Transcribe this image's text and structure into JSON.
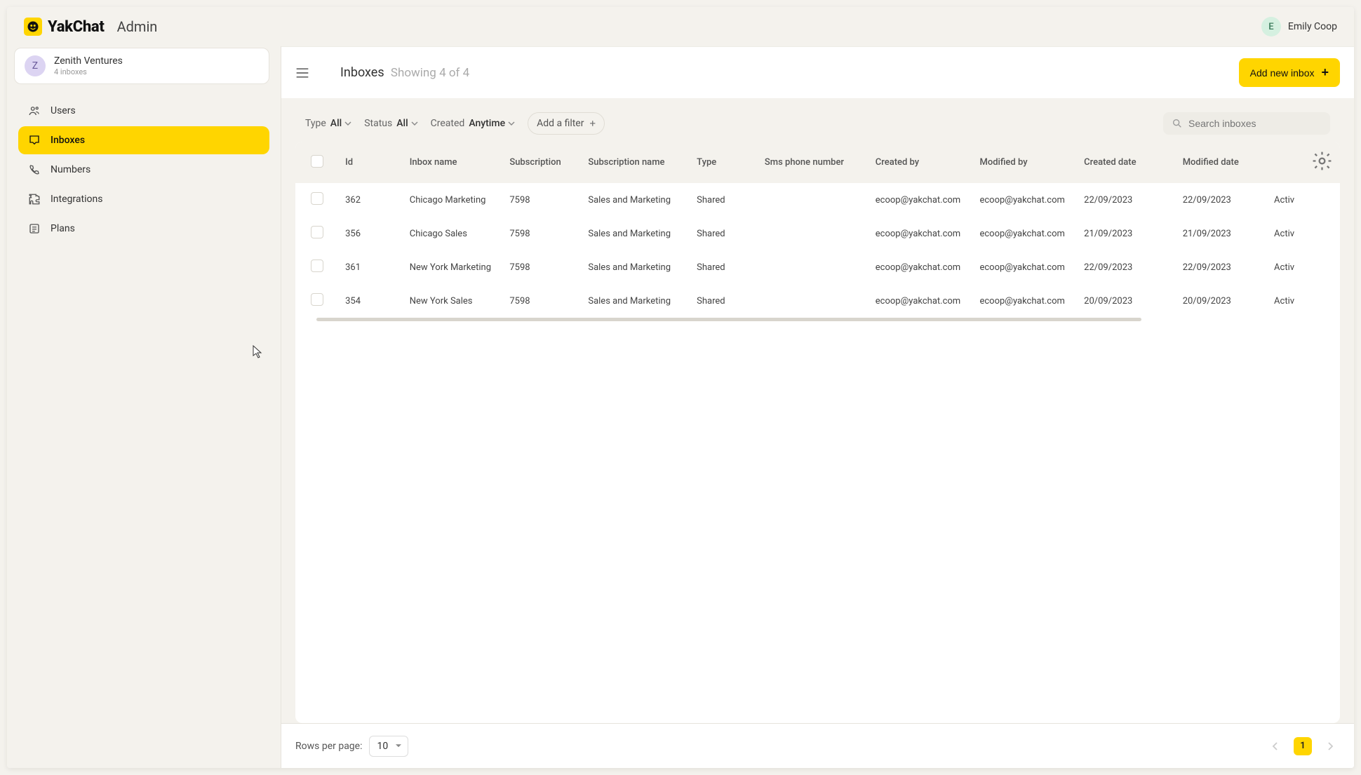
{
  "brand": {
    "name": "YakChat",
    "admin": "Admin"
  },
  "topUser": {
    "initial": "E",
    "name": "Emily Coop"
  },
  "org": {
    "initial": "Z",
    "name": "Zenith Ventures",
    "sub": "4 inboxes"
  },
  "sidebar": {
    "items": [
      {
        "label": "Users"
      },
      {
        "label": "Inboxes"
      },
      {
        "label": "Numbers"
      },
      {
        "label": "Integrations"
      },
      {
        "label": "Plans"
      }
    ],
    "activeIndex": 1
  },
  "page": {
    "title": "Inboxes",
    "subtitle": "Showing 4 of 4",
    "addButton": "Add new inbox"
  },
  "filters": {
    "type": {
      "label": "Type",
      "value": "All"
    },
    "status": {
      "label": "Status",
      "value": "All"
    },
    "created": {
      "label": "Created",
      "value": "Anytime"
    },
    "addFilter": "Add a filter"
  },
  "search": {
    "placeholder": "Search inboxes"
  },
  "table": {
    "headers": [
      "Id",
      "Inbox name",
      "Subscription",
      "Subscription name",
      "Type",
      "Sms phone number",
      "Created by",
      "Modified by",
      "Created date",
      "Modified date",
      ""
    ],
    "rows": [
      {
        "id": "362",
        "inbox": "Chicago Marketing",
        "sub": "7598",
        "subname": "Sales and Marketing",
        "type": "Shared",
        "sms": "",
        "createdBy": "ecoop@yakchat.com",
        "modifiedBy": "ecoop@yakchat.com",
        "createdDate": "22/09/2023",
        "modifiedDate": "22/09/2023",
        "status": "Activ"
      },
      {
        "id": "356",
        "inbox": "Chicago Sales",
        "sub": "7598",
        "subname": "Sales and Marketing",
        "type": "Shared",
        "sms": "",
        "createdBy": "ecoop@yakchat.com",
        "modifiedBy": "ecoop@yakchat.com",
        "createdDate": "21/09/2023",
        "modifiedDate": "21/09/2023",
        "status": "Activ"
      },
      {
        "id": "361",
        "inbox": "New York Marketing",
        "sub": "7598",
        "subname": "Sales and Marketing",
        "type": "Shared",
        "sms": "",
        "createdBy": "ecoop@yakchat.com",
        "modifiedBy": "ecoop@yakchat.com",
        "createdDate": "22/09/2023",
        "modifiedDate": "22/09/2023",
        "status": "Activ"
      },
      {
        "id": "354",
        "inbox": "New York Sales",
        "sub": "7598",
        "subname": "Sales and Marketing",
        "type": "Shared",
        "sms": "",
        "createdBy": "ecoop@yakchat.com",
        "modifiedBy": "ecoop@yakchat.com",
        "createdDate": "20/09/2023",
        "modifiedDate": "20/09/2023",
        "status": "Activ"
      }
    ]
  },
  "pagination": {
    "rowsLabel": "Rows per page:",
    "rowsValue": "10",
    "current": "1"
  }
}
